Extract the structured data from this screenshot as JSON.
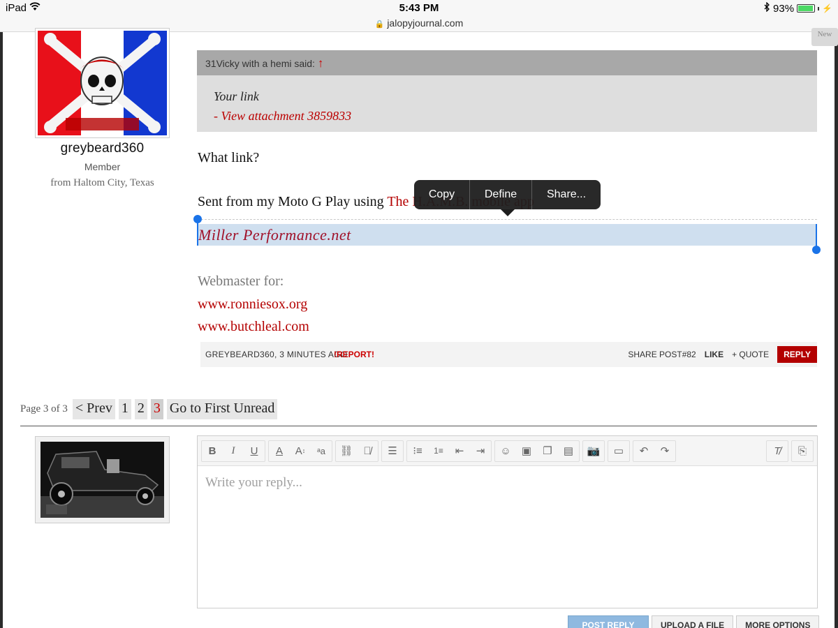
{
  "status_bar": {
    "device": "iPad",
    "time": "5:43 PM",
    "battery": "93%",
    "battery_level": 0.93
  },
  "browser": {
    "url": "jalopyjournal.com",
    "tab_hint": "New"
  },
  "post": {
    "author": {
      "username": "greybeard360",
      "title": "Member",
      "location": "from Haltom City, Texas"
    },
    "quote": {
      "attribution": "31Vicky with a hemi said:",
      "arrow": "↑",
      "line1": "Your link",
      "line2": "- View attachment 3859833"
    },
    "body_line1": "What link?",
    "sent_prefix": "Sent from my Moto G Play using ",
    "sent_link": "The H.A.M.B. mobile app",
    "selected_text": "Miller Performance.net",
    "signature_label": "Webmaster for:",
    "signature_links": [
      "www.ronniesox.org",
      "www.butchleal.com"
    ],
    "footer": {
      "meta": "GREYBEARD360, 3 MINUTES AGO",
      "report_prefix": "!",
      "report": "REPORT",
      "report_suffix": "!",
      "share": "SHARE POST#82",
      "like": "LIKE",
      "quote": "+ QUOTE",
      "reply": "REPLY"
    }
  },
  "callout_menu": {
    "items": [
      "Copy",
      "Define",
      "Share..."
    ]
  },
  "pagination": {
    "label": "Page 3 of 3",
    "prev": "< Prev",
    "pages": [
      "1",
      "2",
      "3"
    ],
    "current": "3",
    "first_unread": "Go to First Unread"
  },
  "reply_editor": {
    "placeholder": "Write your reply...",
    "toolbar_icons": [
      "bold-icon",
      "italic-icon",
      "underline-icon",
      "text-color-icon",
      "font-size-icon",
      "font-family-icon",
      "link-icon",
      "unlink-icon",
      "align-icon",
      "bullet-list-icon",
      "numbered-list-icon",
      "outdent-icon",
      "indent-icon",
      "smilie-icon",
      "image-icon",
      "media-icon",
      "code-icon",
      "camera-icon",
      "save-draft-icon",
      "undo-icon",
      "redo-icon",
      "remove-format-icon",
      "toggle-bbcode-icon"
    ],
    "buttons": {
      "post_reply": "POST REPLY",
      "upload": "UPLOAD A FILE",
      "more_options": "MORE OPTIONS"
    }
  },
  "colors": {
    "accent_red": "#b40000",
    "selection": "#cfdfef",
    "handle_blue": "#1a73e8"
  }
}
